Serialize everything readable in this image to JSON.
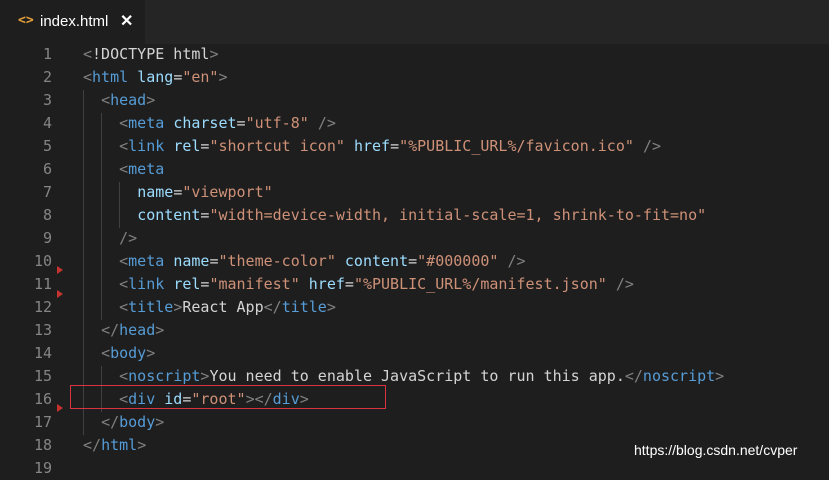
{
  "tab": {
    "title": "index.html",
    "icon": "code-file-icon",
    "close_glyph": "✕"
  },
  "watermark": "https://blog.csdn.net/cvper",
  "lines": [
    {
      "n": "1",
      "tokens": [
        [
          "t-punc",
          "<"
        ],
        [
          "t-text",
          "!DOCTYPE html"
        ],
        [
          "t-punc",
          ">"
        ]
      ]
    },
    {
      "n": "2",
      "tokens": [
        [
          "t-punc",
          "<"
        ],
        [
          "t-tag",
          "html"
        ],
        [
          "t-text",
          " "
        ],
        [
          "t-attr",
          "lang"
        ],
        [
          "t-eq",
          "="
        ],
        [
          "t-str",
          "\"en\""
        ],
        [
          "t-punc",
          ">"
        ]
      ]
    },
    {
      "n": "3",
      "tokens": [
        [
          "t-text",
          "  "
        ],
        [
          "t-punc",
          "<"
        ],
        [
          "t-tag",
          "head"
        ],
        [
          "t-punc",
          ">"
        ]
      ]
    },
    {
      "n": "4",
      "tokens": [
        [
          "t-text",
          "    "
        ],
        [
          "t-punc",
          "<"
        ],
        [
          "t-tag",
          "meta"
        ],
        [
          "t-text",
          " "
        ],
        [
          "t-attr",
          "charset"
        ],
        [
          "t-eq",
          "="
        ],
        [
          "t-str",
          "\"utf-8\""
        ],
        [
          "t-text",
          " "
        ],
        [
          "t-punc",
          "/>"
        ]
      ]
    },
    {
      "n": "5",
      "tokens": [
        [
          "t-text",
          "    "
        ],
        [
          "t-punc",
          "<"
        ],
        [
          "t-tag",
          "link"
        ],
        [
          "t-text",
          " "
        ],
        [
          "t-attr",
          "rel"
        ],
        [
          "t-eq",
          "="
        ],
        [
          "t-str",
          "\"shortcut icon\""
        ],
        [
          "t-text",
          " "
        ],
        [
          "t-attr",
          "href"
        ],
        [
          "t-eq",
          "="
        ],
        [
          "t-str",
          "\"%PUBLIC_URL%/favicon.ico\""
        ],
        [
          "t-text",
          " "
        ],
        [
          "t-punc",
          "/>"
        ]
      ]
    },
    {
      "n": "6",
      "tokens": [
        [
          "t-text",
          "    "
        ],
        [
          "t-punc",
          "<"
        ],
        [
          "t-tag",
          "meta"
        ]
      ]
    },
    {
      "n": "7",
      "tokens": [
        [
          "t-text",
          "      "
        ],
        [
          "t-attr",
          "name"
        ],
        [
          "t-eq",
          "="
        ],
        [
          "t-str",
          "\"viewport\""
        ]
      ]
    },
    {
      "n": "8",
      "tokens": [
        [
          "t-text",
          "      "
        ],
        [
          "t-attr",
          "content"
        ],
        [
          "t-eq",
          "="
        ],
        [
          "t-str",
          "\"width=device-width, initial-scale=1, shrink-to-fit=no\""
        ]
      ]
    },
    {
      "n": "9",
      "tokens": [
        [
          "t-text",
          "    "
        ],
        [
          "t-punc",
          "/>"
        ]
      ]
    },
    {
      "n": "10",
      "tokens": [
        [
          "t-text",
          "    "
        ],
        [
          "t-punc",
          "<"
        ],
        [
          "t-tag",
          "meta"
        ],
        [
          "t-text",
          " "
        ],
        [
          "t-attr",
          "name"
        ],
        [
          "t-eq",
          "="
        ],
        [
          "t-str",
          "\"theme-color\""
        ],
        [
          "t-text",
          " "
        ],
        [
          "t-attr",
          "content"
        ],
        [
          "t-eq",
          "="
        ],
        [
          "t-str",
          "\"#000000\""
        ],
        [
          "t-text",
          " "
        ],
        [
          "t-punc",
          "/>"
        ]
      ]
    },
    {
      "n": "11",
      "tokens": [
        [
          "t-text",
          "    "
        ],
        [
          "t-punc",
          "<"
        ],
        [
          "t-tag",
          "link"
        ],
        [
          "t-text",
          " "
        ],
        [
          "t-attr",
          "rel"
        ],
        [
          "t-eq",
          "="
        ],
        [
          "t-str",
          "\"manifest\""
        ],
        [
          "t-text",
          " "
        ],
        [
          "t-attr",
          "href"
        ],
        [
          "t-eq",
          "="
        ],
        [
          "t-str",
          "\"%PUBLIC_URL%/manifest.json\""
        ],
        [
          "t-text",
          " "
        ],
        [
          "t-punc",
          "/>"
        ]
      ]
    },
    {
      "n": "12",
      "tokens": [
        [
          "t-text",
          "    "
        ],
        [
          "t-punc",
          "<"
        ],
        [
          "t-tag",
          "title"
        ],
        [
          "t-punc",
          ">"
        ],
        [
          "t-text",
          "React App"
        ],
        [
          "t-punc",
          "</"
        ],
        [
          "t-tag",
          "title"
        ],
        [
          "t-punc",
          ">"
        ]
      ]
    },
    {
      "n": "13",
      "tokens": [
        [
          "t-text",
          "  "
        ],
        [
          "t-punc",
          "</"
        ],
        [
          "t-tag",
          "head"
        ],
        [
          "t-punc",
          ">"
        ]
      ]
    },
    {
      "n": "14",
      "tokens": [
        [
          "t-text",
          "  "
        ],
        [
          "t-punc",
          "<"
        ],
        [
          "t-tag",
          "body"
        ],
        [
          "t-punc",
          ">"
        ]
      ]
    },
    {
      "n": "15",
      "tokens": [
        [
          "t-text",
          "    "
        ],
        [
          "t-punc",
          "<"
        ],
        [
          "t-tag",
          "noscript"
        ],
        [
          "t-punc",
          ">"
        ],
        [
          "t-text",
          "You need to enable JavaScript to run this app."
        ],
        [
          "t-punc",
          "</"
        ],
        [
          "t-tag",
          "noscript"
        ],
        [
          "t-punc",
          ">"
        ]
      ]
    },
    {
      "n": "16",
      "tokens": [
        [
          "t-text",
          "    "
        ],
        [
          "t-punc",
          "<"
        ],
        [
          "t-tag",
          "div"
        ],
        [
          "t-text",
          " "
        ],
        [
          "t-attr",
          "id"
        ],
        [
          "t-eq",
          "="
        ],
        [
          "t-str",
          "\"root\""
        ],
        [
          "t-punc",
          "></"
        ],
        [
          "t-tag",
          "div"
        ],
        [
          "t-punc",
          ">"
        ]
      ]
    },
    {
      "n": "17",
      "tokens": [
        [
          "t-text",
          "  "
        ],
        [
          "t-punc",
          "</"
        ],
        [
          "t-tag",
          "body"
        ],
        [
          "t-punc",
          ">"
        ]
      ]
    },
    {
      "n": "18",
      "tokens": [
        [
          "t-punc",
          "</"
        ],
        [
          "t-tag",
          "html"
        ],
        [
          "t-punc",
          ">"
        ]
      ]
    },
    {
      "n": "19",
      "tokens": []
    }
  ]
}
